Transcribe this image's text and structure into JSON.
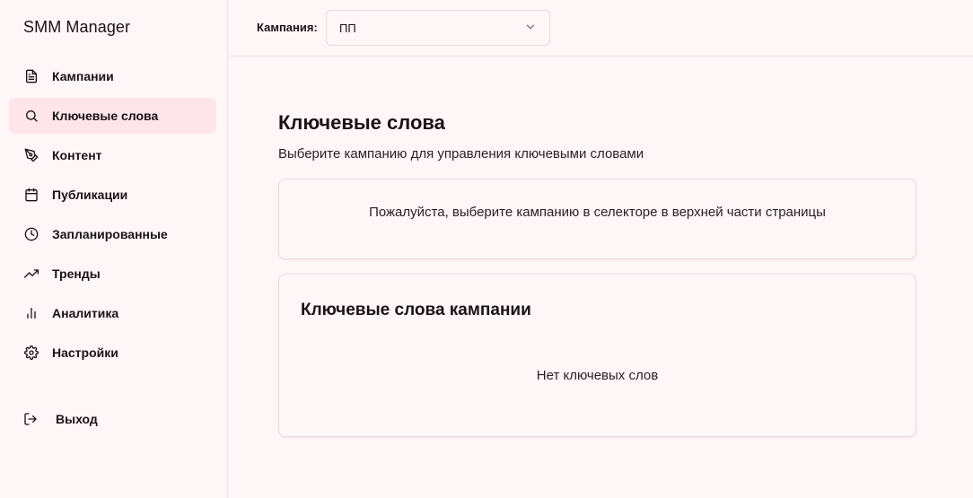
{
  "app": {
    "title": "SMM Manager"
  },
  "sidebar": {
    "items": [
      {
        "label": "Кампании",
        "icon": "document-icon",
        "active": false
      },
      {
        "label": "Ключевые слова",
        "icon": "search-icon",
        "active": true
      },
      {
        "label": "Контент",
        "icon": "pen-tool-icon",
        "active": false
      },
      {
        "label": "Публикации",
        "icon": "calendar-icon",
        "active": false
      },
      {
        "label": "Запланированные",
        "icon": "clock-icon",
        "active": false
      },
      {
        "label": "Тренды",
        "icon": "trending-up-icon",
        "active": false
      },
      {
        "label": "Аналитика",
        "icon": "bar-chart-icon",
        "active": false
      },
      {
        "label": "Настройки",
        "icon": "gear-icon",
        "active": false
      }
    ],
    "logout": {
      "label": "Выход",
      "icon": "logout-icon"
    }
  },
  "topbar": {
    "campaign_label": "Кампания:",
    "campaign_selected": "ПП"
  },
  "main": {
    "title": "Ключевые слова",
    "subtitle": "Выберите кампанию для управления ключевыми словами",
    "notice": "Пожалуйста, выберите кампанию в селекторе в верхней части страницы",
    "keywords_card": {
      "title": "Ключевые слова кампании",
      "empty": "Нет ключевых слов"
    }
  },
  "colors": {
    "background": "#fff6f7",
    "active_item": "#fde5ea",
    "border": "#f0d9de",
    "text": "#1b1214"
  }
}
